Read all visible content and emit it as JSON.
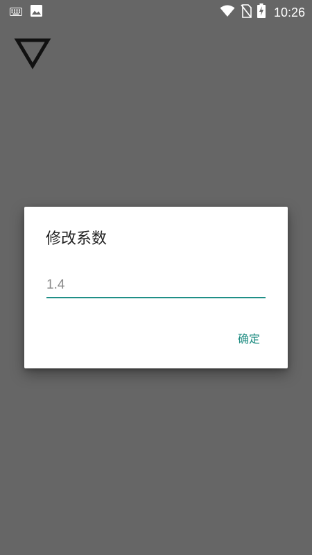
{
  "status_bar": {
    "time": "10:26",
    "icons_left": [
      "keyboard-icon",
      "image-icon"
    ],
    "icons_right": [
      "wifi-icon",
      "no-sim-icon",
      "battery-charging-icon"
    ]
  },
  "app": {
    "icon": "nabla-triangle-icon"
  },
  "dialog": {
    "title": "修改系数",
    "input": {
      "value": "",
      "placeholder": "1.4"
    },
    "confirm_label": "确定",
    "accent_color": "#1a8a7f"
  },
  "colors": {
    "background": "#666666",
    "dialog_background": "#ffffff",
    "accent": "#1f8f87"
  }
}
